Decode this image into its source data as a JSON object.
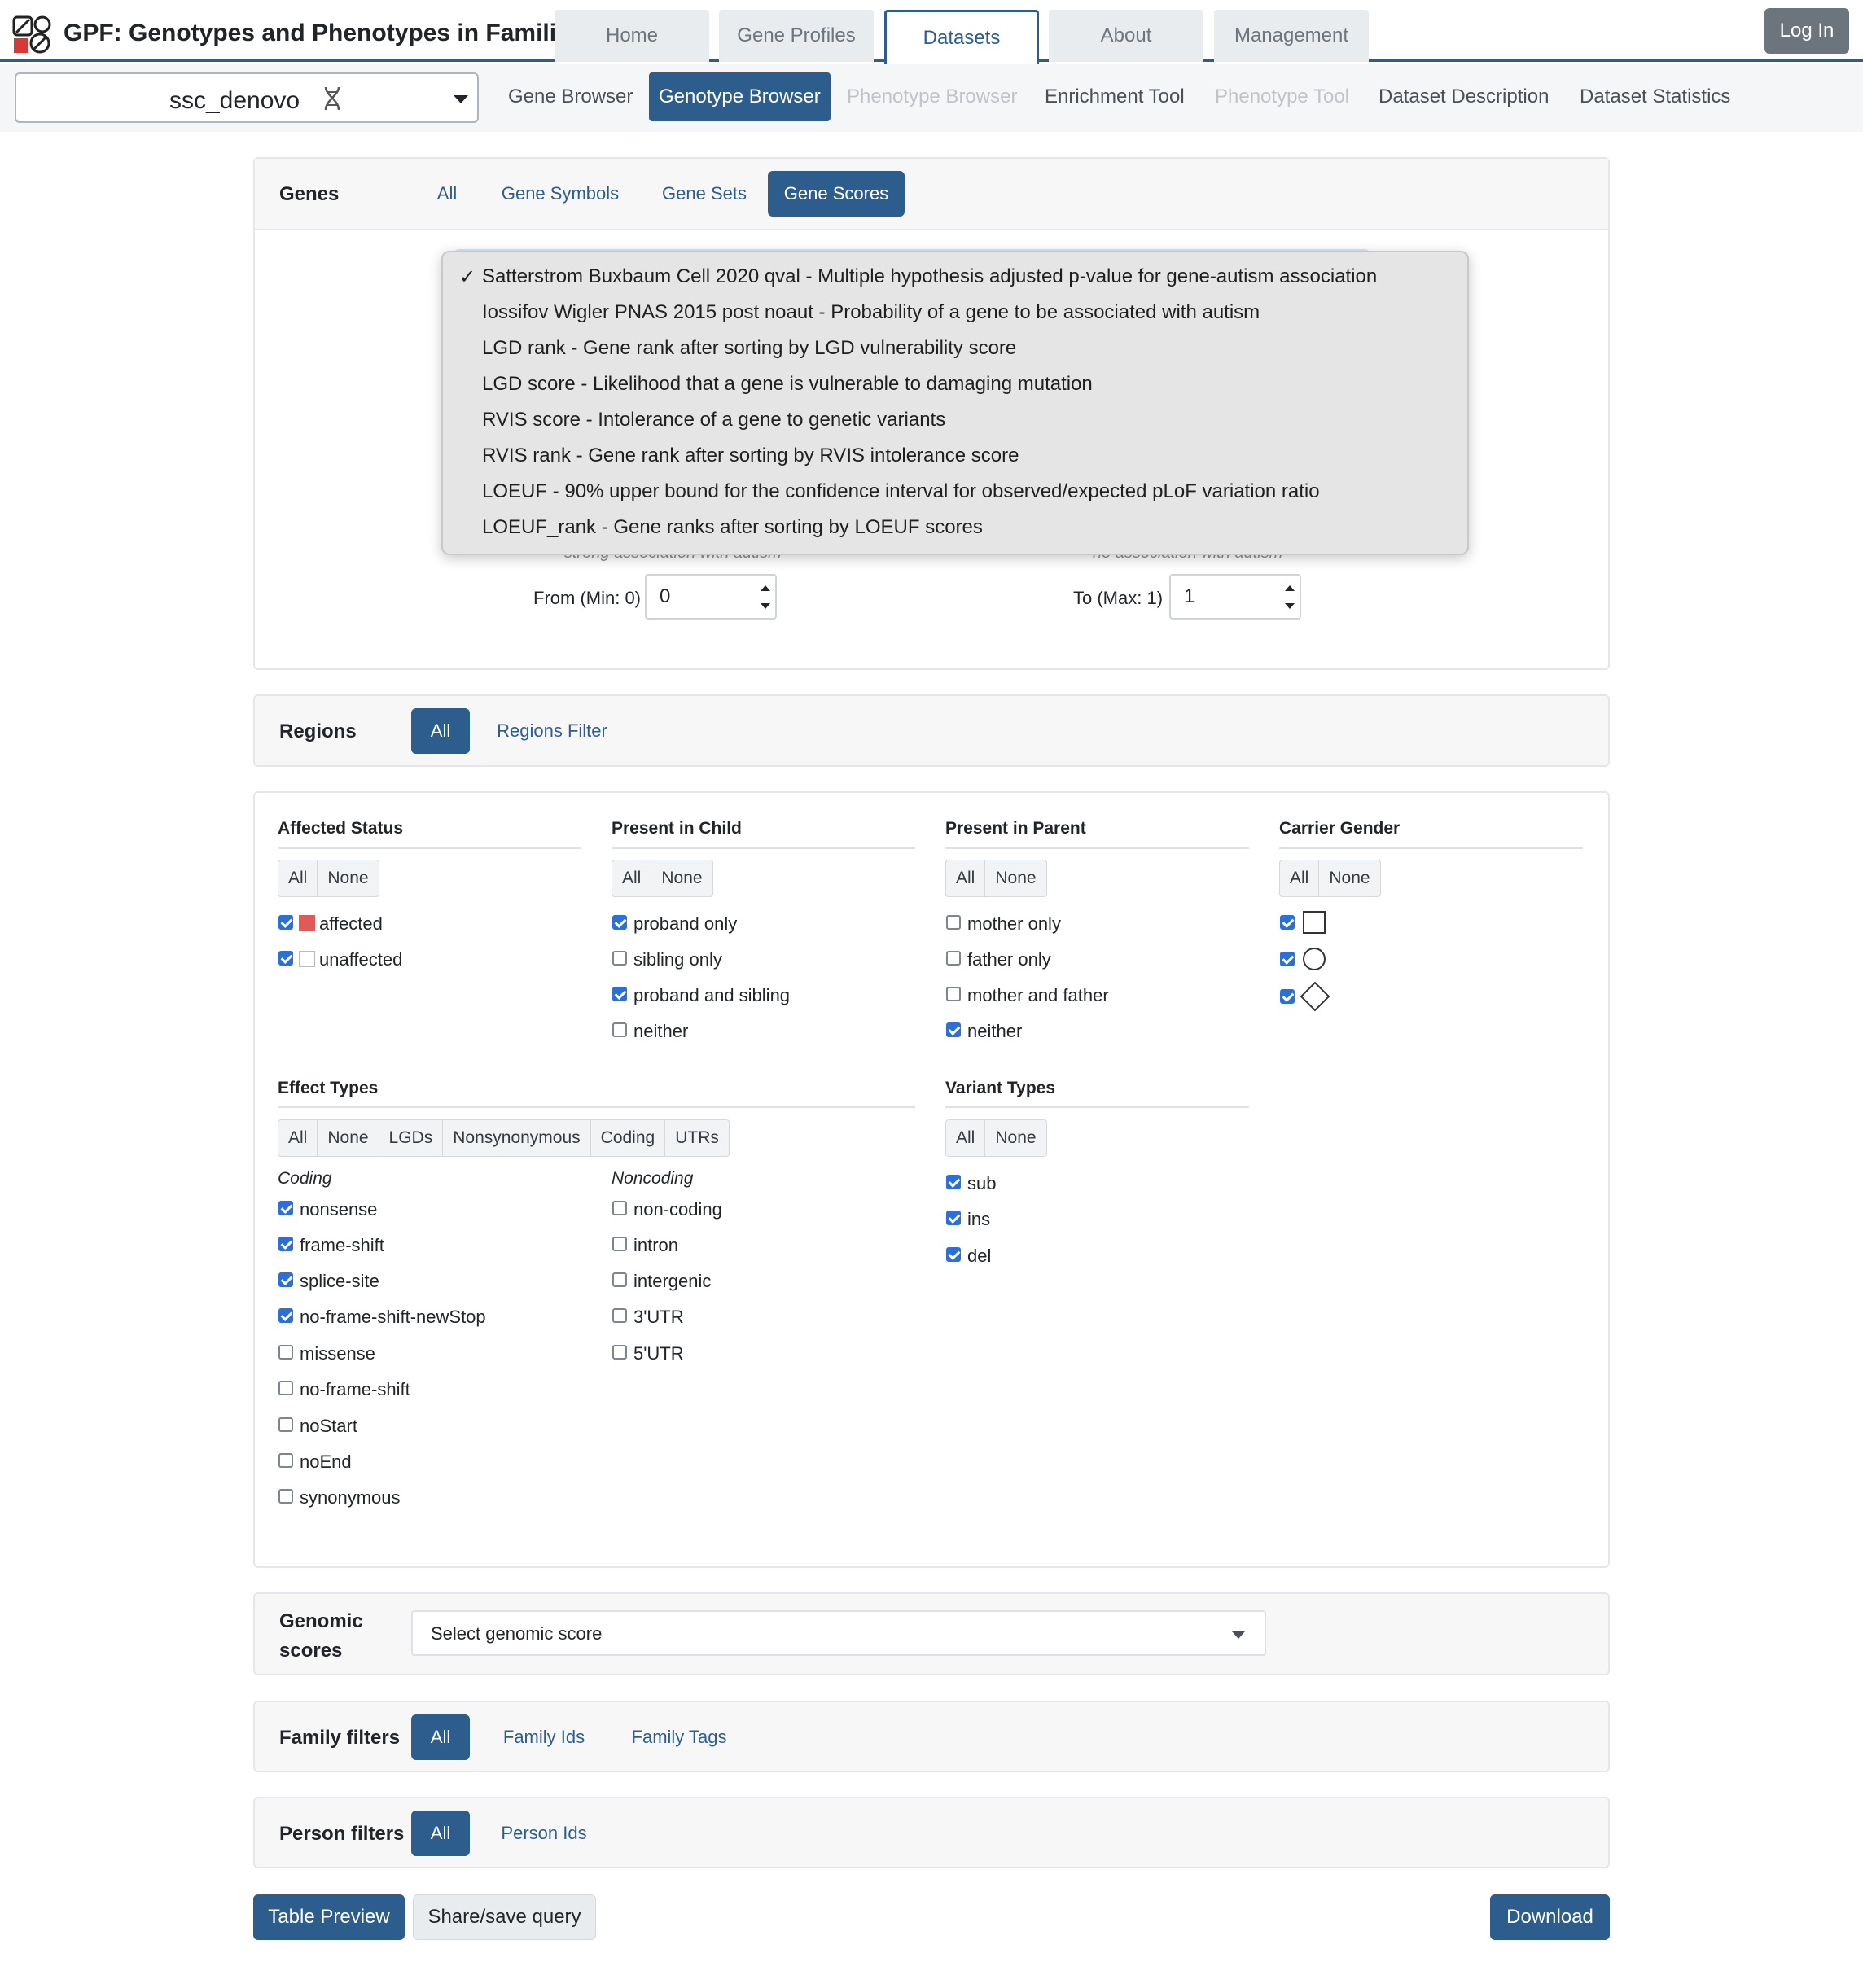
{
  "app": {
    "title": "GPF: Genotypes and Phenotypes in Families",
    "login": "Log In"
  },
  "main_tabs": [
    "Home",
    "Gene Profiles",
    "Datasets",
    "About",
    "Management"
  ],
  "dataset": {
    "name": "ssc_denovo"
  },
  "subnav": [
    "Gene Browser",
    "Genotype Browser",
    "Phenotype Browser",
    "Enrichment Tool",
    "Phenotype Tool",
    "Dataset Description",
    "Dataset Statistics"
  ],
  "genes": {
    "title": "Genes",
    "tabs": [
      "All",
      "Gene Symbols",
      "Gene Sets",
      "Gene Scores"
    ],
    "score_options": [
      "Satterstrom Buxbaum Cell 2020 qval - Multiple hypothesis adjusted p-value for gene-autism association",
      "Iossifov Wigler PNAS 2015 post noaut - Probability of a gene to be associated with autism",
      "LGD rank - Gene rank after sorting by LGD vulnerability score",
      "LGD score - Likelihood that a gene is vulnerable to damaging mutation",
      "RVIS score - Intolerance of a gene to genetic variants",
      "RVIS rank - Gene rank after sorting by RVIS intolerance score",
      "LOEUF - 90% upper bound for the confidence interval for observed/expected pLoF variation ratio",
      "LOEUF_rank - Gene ranks after sorting by LOEUF scores"
    ],
    "hint_left": "strong association with autism",
    "hint_right": "no association with autism",
    "from_label": "From (Min: 0)",
    "from_value": "0",
    "to_label": "To (Max: 1)",
    "to_value": "1"
  },
  "regions": {
    "title": "Regions",
    "tabs": [
      "All",
      "Regions Filter"
    ]
  },
  "affected_status": {
    "title": "Affected Status",
    "buttons": [
      "All",
      "None"
    ],
    "items": [
      {
        "label": "affected",
        "checked": true,
        "color": "#e05a5a"
      },
      {
        "label": "unaffected",
        "checked": true,
        "color": "#ffffff"
      }
    ]
  },
  "present_in_child": {
    "title": "Present in Child",
    "buttons": [
      "All",
      "None"
    ],
    "items": [
      {
        "label": "proband only",
        "checked": true
      },
      {
        "label": "sibling only",
        "checked": false
      },
      {
        "label": "proband and sibling",
        "checked": true
      },
      {
        "label": "neither",
        "checked": false
      }
    ]
  },
  "present_in_parent": {
    "title": "Present in Parent",
    "buttons": [
      "All",
      "None"
    ],
    "items": [
      {
        "label": "mother only",
        "checked": false
      },
      {
        "label": "father only",
        "checked": false
      },
      {
        "label": "mother and father",
        "checked": false
      },
      {
        "label": "neither",
        "checked": true
      }
    ]
  },
  "carrier_gender": {
    "title": "Carrier Gender",
    "buttons": [
      "All",
      "None"
    ],
    "items": [
      {
        "shape": "square-icon",
        "checked": true
      },
      {
        "shape": "circle-icon",
        "checked": true
      },
      {
        "shape": "diamond-icon",
        "checked": true
      }
    ]
  },
  "effect_types": {
    "title": "Effect Types",
    "buttons": [
      "All",
      "None",
      "LGDs",
      "Nonsynonymous",
      "Coding",
      "UTRs"
    ],
    "coding_title": "Coding",
    "coding": [
      {
        "label": "nonsense",
        "checked": true
      },
      {
        "label": "frame-shift",
        "checked": true
      },
      {
        "label": "splice-site",
        "checked": true
      },
      {
        "label": "no-frame-shift-newStop",
        "checked": true
      },
      {
        "label": "missense",
        "checked": false
      },
      {
        "label": "no-frame-shift",
        "checked": false
      },
      {
        "label": "noStart",
        "checked": false
      },
      {
        "label": "noEnd",
        "checked": false
      },
      {
        "label": "synonymous",
        "checked": false
      }
    ],
    "noncoding_title": "Noncoding",
    "noncoding": [
      {
        "label": "non-coding",
        "checked": false
      },
      {
        "label": "intron",
        "checked": false
      },
      {
        "label": "intergenic",
        "checked": false
      },
      {
        "label": "3'UTR",
        "checked": false
      },
      {
        "label": "5'UTR",
        "checked": false
      }
    ]
  },
  "variant_types": {
    "title": "Variant Types",
    "buttons": [
      "All",
      "None"
    ],
    "items": [
      {
        "label": "sub",
        "checked": true
      },
      {
        "label": "ins",
        "checked": true
      },
      {
        "label": "del",
        "checked": true
      }
    ]
  },
  "genomic_scores": {
    "title_line1": "Genomic",
    "title_line2": "scores",
    "placeholder": "Select genomic score"
  },
  "family_filters": {
    "title": "Family filters",
    "tabs": [
      "All",
      "Family Ids",
      "Family Tags"
    ]
  },
  "person_filters": {
    "title": "Person filters",
    "tabs": [
      "All",
      "Person Ids"
    ]
  },
  "actions": {
    "table_preview": "Table Preview",
    "share": "Share/save query",
    "download": "Download"
  },
  "colors": {
    "primary": "#2c5d8c",
    "checkbox": "#2c6fd8"
  }
}
